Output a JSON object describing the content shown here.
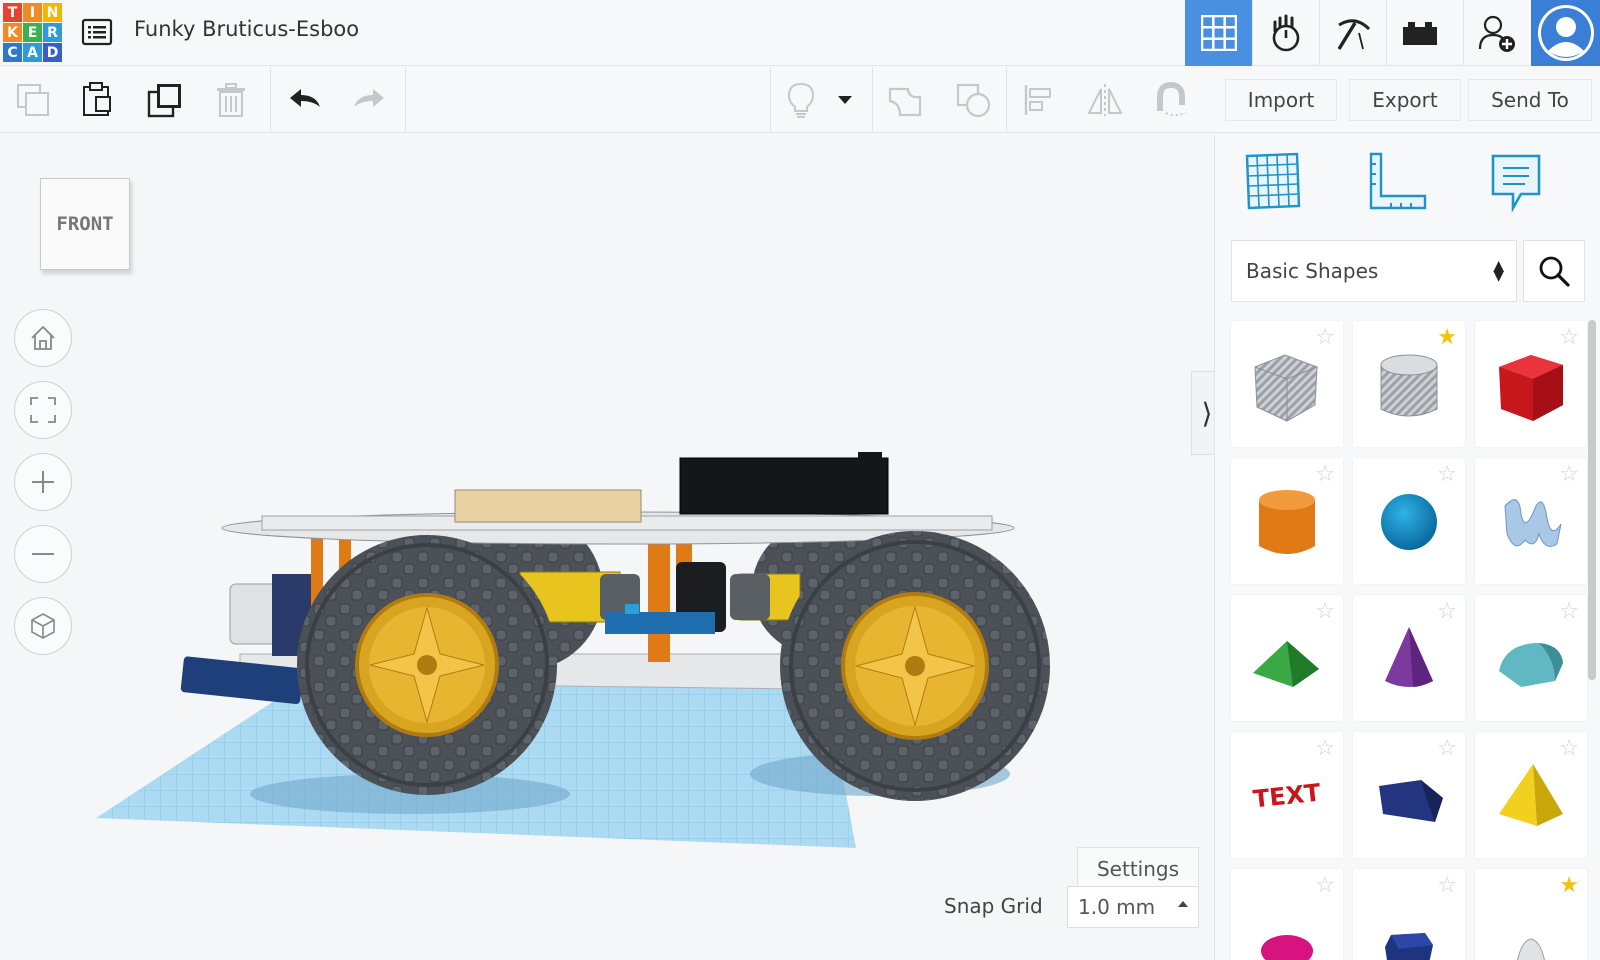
{
  "app": {
    "logo_letters": [
      "T",
      "I",
      "N",
      "K",
      "E",
      "R",
      "C",
      "A",
      "D"
    ],
    "logo_colors": [
      "#e8432e",
      "#f08a24",
      "#f5b400",
      "#f08a24",
      "#3daf4f",
      "#2e9ad6",
      "#2e79c8",
      "#2e9ad6",
      "#3a5ec8"
    ],
    "design_title": "Funky Bruticus-Esboo"
  },
  "nav": {
    "items": [
      "3D Design",
      "Simulation",
      "Build",
      "Blocks",
      "Invite"
    ],
    "active": "3D Design",
    "accent": "#4a90e2"
  },
  "toolbar": {
    "left_icons": [
      "copy-icon",
      "paste-icon",
      "duplicate-icon",
      "delete-icon",
      "undo-icon",
      "redo-icon"
    ],
    "right_icons": [
      "light-bulb-icon",
      "dropdown-icon",
      "group-icon",
      "ungroup-icon",
      "align-icon",
      "mirror-icon",
      "magnet-icon"
    ]
  },
  "actions": {
    "import_label": "Import",
    "export_label": "Export",
    "send_to_label": "Send To"
  },
  "viewcube": {
    "face_label": "FRONT"
  },
  "view_controls": [
    "home-view",
    "fit-all",
    "zoom-in",
    "zoom-out",
    "ortho-toggle"
  ],
  "workplane": {
    "settings_label": "Settings",
    "snap_grid_label": "Snap Grid",
    "snap_grid_value": "1.0 mm"
  },
  "panel": {
    "tabs": [
      "workplane-icon",
      "ruler-icon",
      "notes-icon"
    ],
    "library_select": "Basic Shapes",
    "shapes": [
      {
        "name": "Box (hole)",
        "favorite": false
      },
      {
        "name": "Cylinder (hole)",
        "favorite": true
      },
      {
        "name": "Box",
        "favorite": false
      },
      {
        "name": "Cylinder",
        "favorite": false
      },
      {
        "name": "Sphere",
        "favorite": false
      },
      {
        "name": "Scribble",
        "favorite": false
      },
      {
        "name": "Roof",
        "favorite": false
      },
      {
        "name": "Cone",
        "favorite": false
      },
      {
        "name": "Round Roof",
        "favorite": false
      },
      {
        "name": "Text",
        "favorite": false
      },
      {
        "name": "Wedge",
        "favorite": false
      },
      {
        "name": "Pyramid",
        "favorite": false
      },
      {
        "name": "Half Sphere",
        "favorite": false
      },
      {
        "name": "Polygon",
        "favorite": false
      },
      {
        "name": "Paraboloid",
        "favorite": true
      }
    ],
    "text_shape_label": "TEXT"
  }
}
